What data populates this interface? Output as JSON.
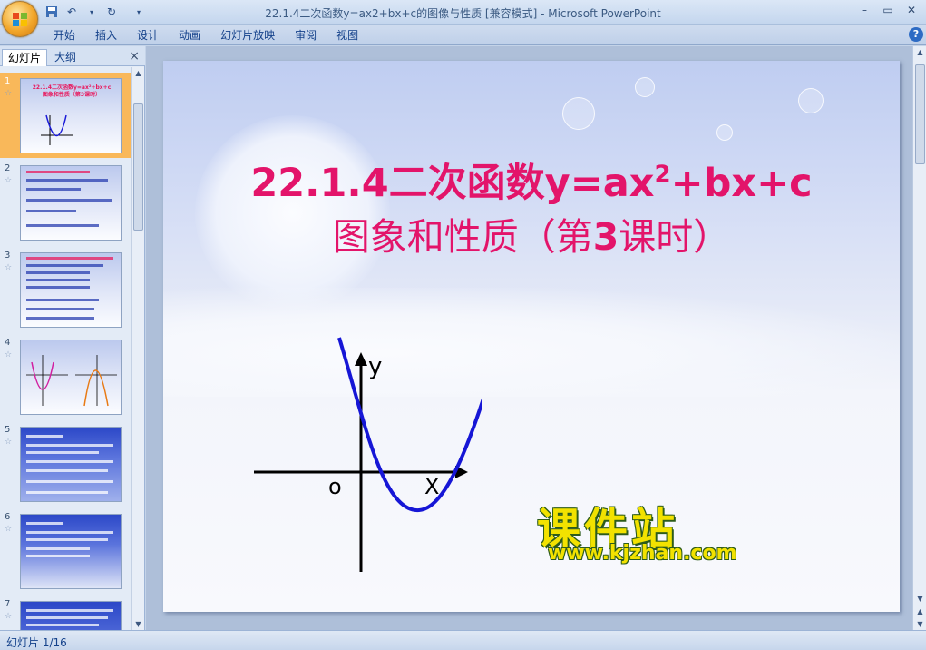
{
  "window": {
    "title": "22.1.4二次函数y=ax2+bx+c的图像与性质 [兼容模式] - Microsoft PowerPoint",
    "controls": [
      "–",
      "▭",
      "✕"
    ]
  },
  "ribbon": {
    "tabs": [
      "开始",
      "插入",
      "设计",
      "动画",
      "幻灯片放映",
      "审阅",
      "视图"
    ]
  },
  "left_panel": {
    "tab_slides": "幻灯片",
    "tab_outline": "大纲",
    "close": "×",
    "slides": [
      {
        "num": "1",
        "title": "22.1.4二次函数y=ax²+bx+c 图象和性质（第3课时）"
      },
      {
        "num": "2"
      },
      {
        "num": "3"
      },
      {
        "num": "4"
      },
      {
        "num": "5"
      },
      {
        "num": "6"
      },
      {
        "num": "7"
      }
    ]
  },
  "slide": {
    "title_line1_a": "22.1.4二次函数y=ax",
    "title_sup": "2",
    "title_line1_b": "+bx+c",
    "title_line2_a": "图象和性质（第",
    "title_line2_bold": "3",
    "title_line2_b": "课时）",
    "graph_labels": {
      "y": "y",
      "o": "o",
      "x": "X"
    }
  },
  "watermark": {
    "chinese": "课件站",
    "url": "www.kjzhan.com"
  },
  "statusbar": {
    "slide_indicator": "幻灯片 1/16"
  }
}
